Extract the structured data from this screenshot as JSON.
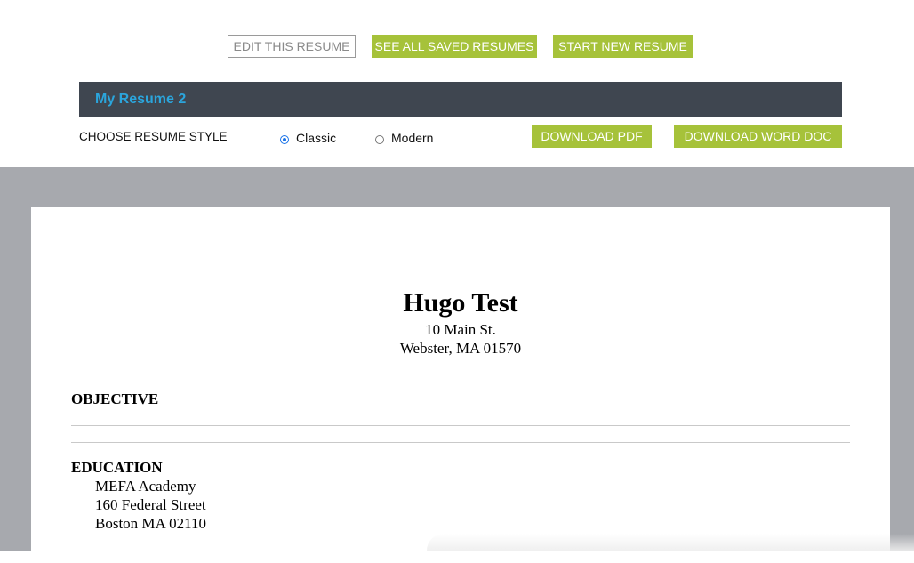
{
  "toolbar": {
    "edit_label": "EDIT THIS RESUME",
    "saved_label": "SEE ALL SAVED RESUMES",
    "new_label": "START NEW RESUME"
  },
  "resume_bar": {
    "title": "My Resume 2"
  },
  "style_chooser": {
    "label": "CHOOSE RESUME STYLE",
    "options": [
      {
        "label": "Classic",
        "selected": true
      },
      {
        "label": "Modern",
        "selected": false
      }
    ]
  },
  "downloads": {
    "pdf_label": "DOWNLOAD PDF",
    "word_label": "DOWNLOAD WORD DOC"
  },
  "resume": {
    "name": "Hugo Test",
    "address_line1": "10 Main St.",
    "address_line2": "Webster, MA 01570",
    "objective_heading": "OBJECTIVE",
    "education_heading": "EDUCATION",
    "education_lines": [
      "MEFA Academy",
      "160 Federal Street",
      "Boston MA 02110"
    ]
  },
  "colors": {
    "accent_green": "#a6c23a",
    "title_bar": "#3f4650",
    "title_text": "#2ba5dc",
    "preview_bg": "#a7a9ae"
  }
}
